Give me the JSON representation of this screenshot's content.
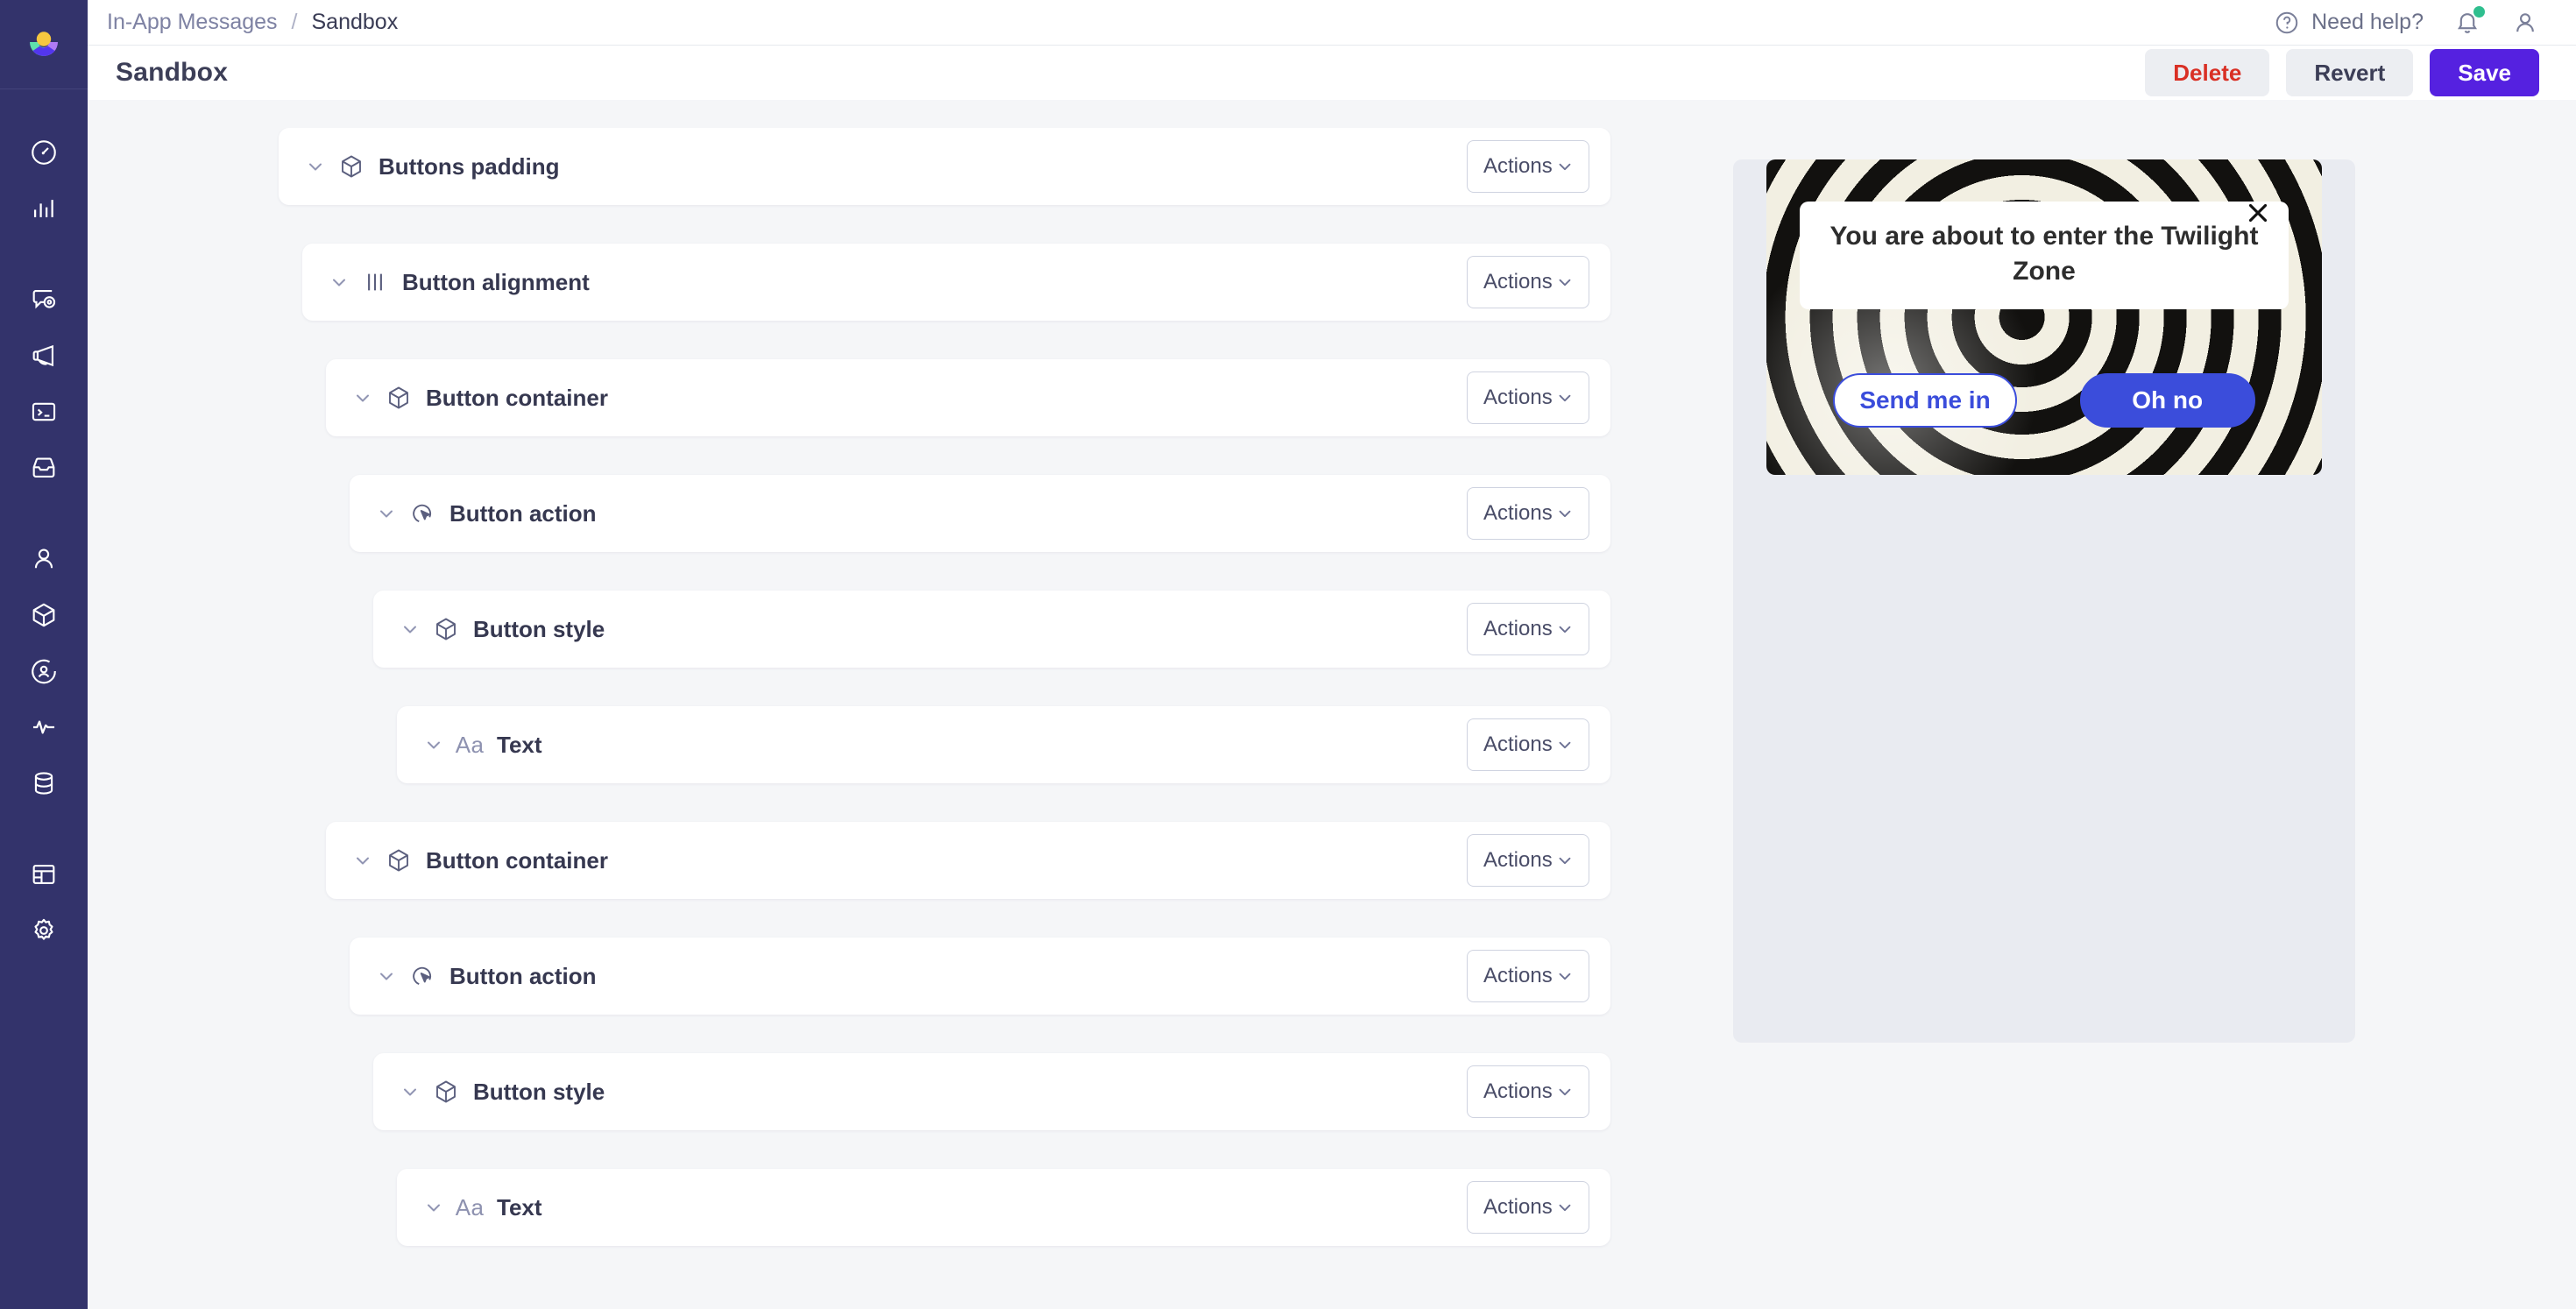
{
  "brand": {
    "logo_name": "braze-logo",
    "sidebar_bg": "#33336b",
    "accent": "#5521e0"
  },
  "topbar": {
    "breadcrumb": {
      "parent": "In-App Messages",
      "separator": "/",
      "current": "Sandbox"
    },
    "need_help_label": "Need help?",
    "help_icon": "question-circle-icon",
    "notifications_icon": "bell-icon",
    "notifications_has_badge": true,
    "account_icon": "user-icon"
  },
  "page_header": {
    "title": "Sandbox",
    "buttons": [
      {
        "label": "Delete",
        "style": "danger",
        "name": "delete-button"
      },
      {
        "label": "Revert",
        "style": "ghost",
        "name": "revert-button"
      },
      {
        "label": "Save",
        "style": "primary",
        "name": "save-button"
      }
    ]
  },
  "sidebar": {
    "items": [
      {
        "icon": "dashboard-gauge-icon",
        "name": "sidebar-item-dashboard"
      },
      {
        "icon": "analytics-bar-chart-icon",
        "name": "sidebar-item-analytics"
      },
      {
        "icon": "messaging-bubble-icon",
        "name": "sidebar-item-messaging"
      },
      {
        "icon": "campaigns-megaphone-icon",
        "name": "sidebar-item-campaigns"
      },
      {
        "icon": "developer-console-icon",
        "name": "sidebar-item-developer-console"
      },
      {
        "icon": "inbox-tray-icon",
        "name": "sidebar-item-inbox"
      },
      {
        "icon": "users-person-icon",
        "name": "sidebar-item-users"
      },
      {
        "icon": "catalog-cube-icon",
        "name": "sidebar-item-catalogs"
      },
      {
        "icon": "audience-target-icon",
        "name": "sidebar-item-audience"
      },
      {
        "icon": "activity-pulse-icon",
        "name": "sidebar-item-activity"
      },
      {
        "icon": "database-stack-icon",
        "name": "sidebar-item-data"
      },
      {
        "icon": "templates-layout-icon",
        "name": "sidebar-item-templates"
      },
      {
        "icon": "settings-gear-icon",
        "name": "sidebar-item-settings"
      }
    ]
  },
  "tree": {
    "actions_label": "Actions",
    "chevron_icon": "chevron-down-icon",
    "rows": [
      {
        "label": "Buttons padding",
        "icon": "cube-icon",
        "depth": 0
      },
      {
        "label": "Button alignment",
        "icon": "alignment-bars-icon",
        "depth": 1
      },
      {
        "label": "Button container",
        "icon": "cube-icon",
        "depth": 2
      },
      {
        "label": "Button action",
        "icon": "click-target-icon",
        "depth": 3
      },
      {
        "label": "Button style",
        "icon": "cube-icon",
        "depth": 4
      },
      {
        "label": "Text",
        "icon": "aa-text-icon",
        "depth": 5
      },
      {
        "label": "Button container",
        "icon": "cube-icon",
        "depth": 2
      },
      {
        "label": "Button action",
        "icon": "click-target-icon",
        "depth": 3
      },
      {
        "label": "Button style",
        "icon": "cube-icon",
        "depth": 4
      },
      {
        "label": "Text",
        "icon": "aa-text-icon",
        "depth": 5
      }
    ]
  },
  "preview": {
    "message": {
      "headline": "You are about to enter the Twilight Zone",
      "close_icon": "close-x-icon",
      "background": "hypnotic-spiral-image",
      "buttons": [
        {
          "label": "Send me in",
          "style": "secondary",
          "name": "iam-button-send-me-in"
        },
        {
          "label": "Oh no",
          "style": "primary",
          "name": "iam-button-oh-no"
        }
      ],
      "button_primary_color": "#3b4ddb"
    }
  }
}
